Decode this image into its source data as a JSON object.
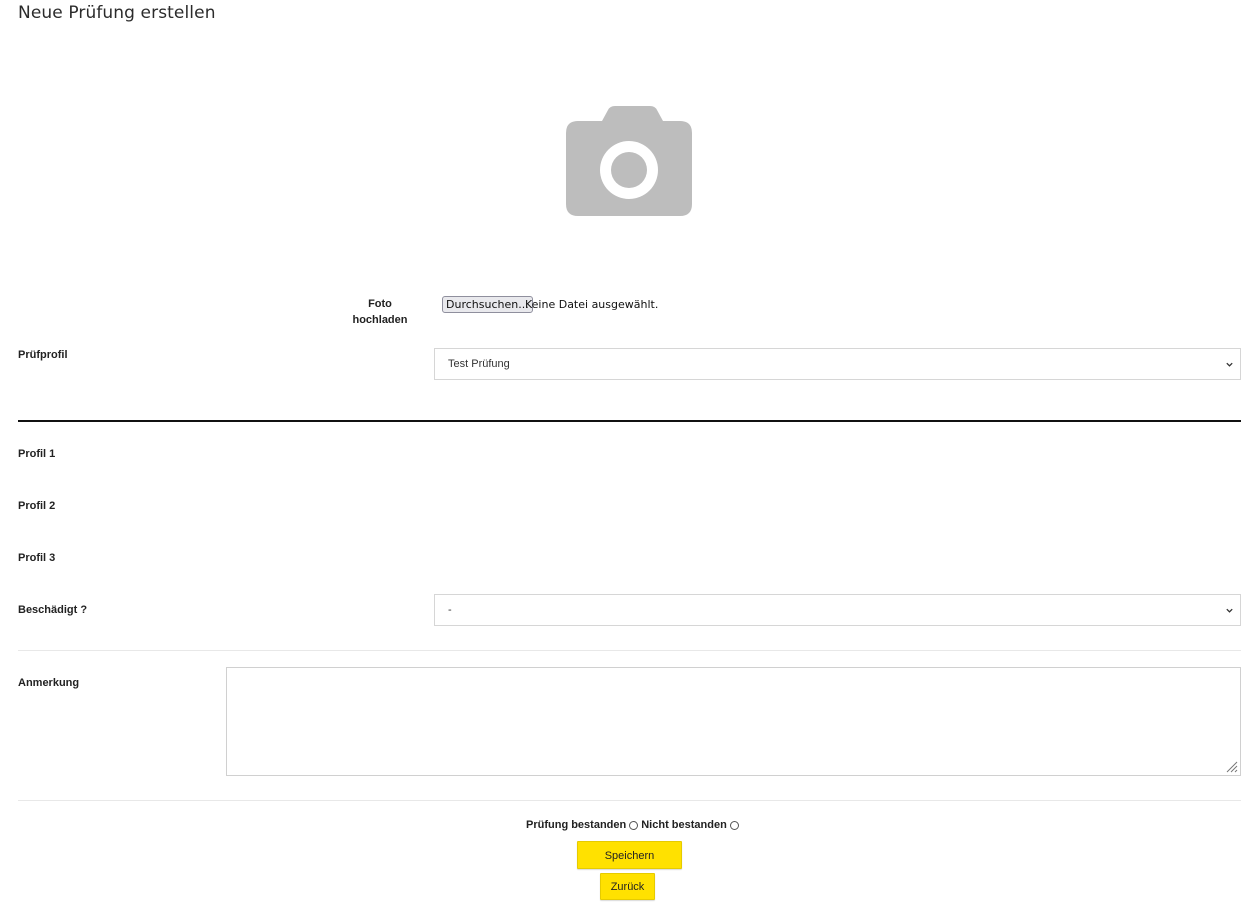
{
  "page": {
    "title": "Neue Prüfung erstellen"
  },
  "photo": {
    "placeholder_icon": "camera-icon",
    "upload_label_line1": "Foto",
    "upload_label_line2": "hochladen",
    "browse_button": "Durchsuchen...",
    "file_status": "Keine Datei ausgewählt."
  },
  "pruefprofil": {
    "label": "Prüfprofil",
    "selected": "Test Prüfung"
  },
  "profiles": [
    {
      "label": "Profil 1"
    },
    {
      "label": "Profil 2"
    },
    {
      "label": "Profil 3"
    }
  ],
  "beschaedigt": {
    "label": "Beschädigt ?",
    "selected": "-"
  },
  "anmerkung": {
    "label": "Anmerkung",
    "value": ""
  },
  "result": {
    "passed_label": "Prüfung bestanden",
    "failed_label": "Nicht bestanden"
  },
  "actions": {
    "save_label": "Speichern",
    "back_label": "Zurück"
  },
  "colors": {
    "accent": "#ffe100",
    "icon_gray": "#bdbdbd"
  }
}
